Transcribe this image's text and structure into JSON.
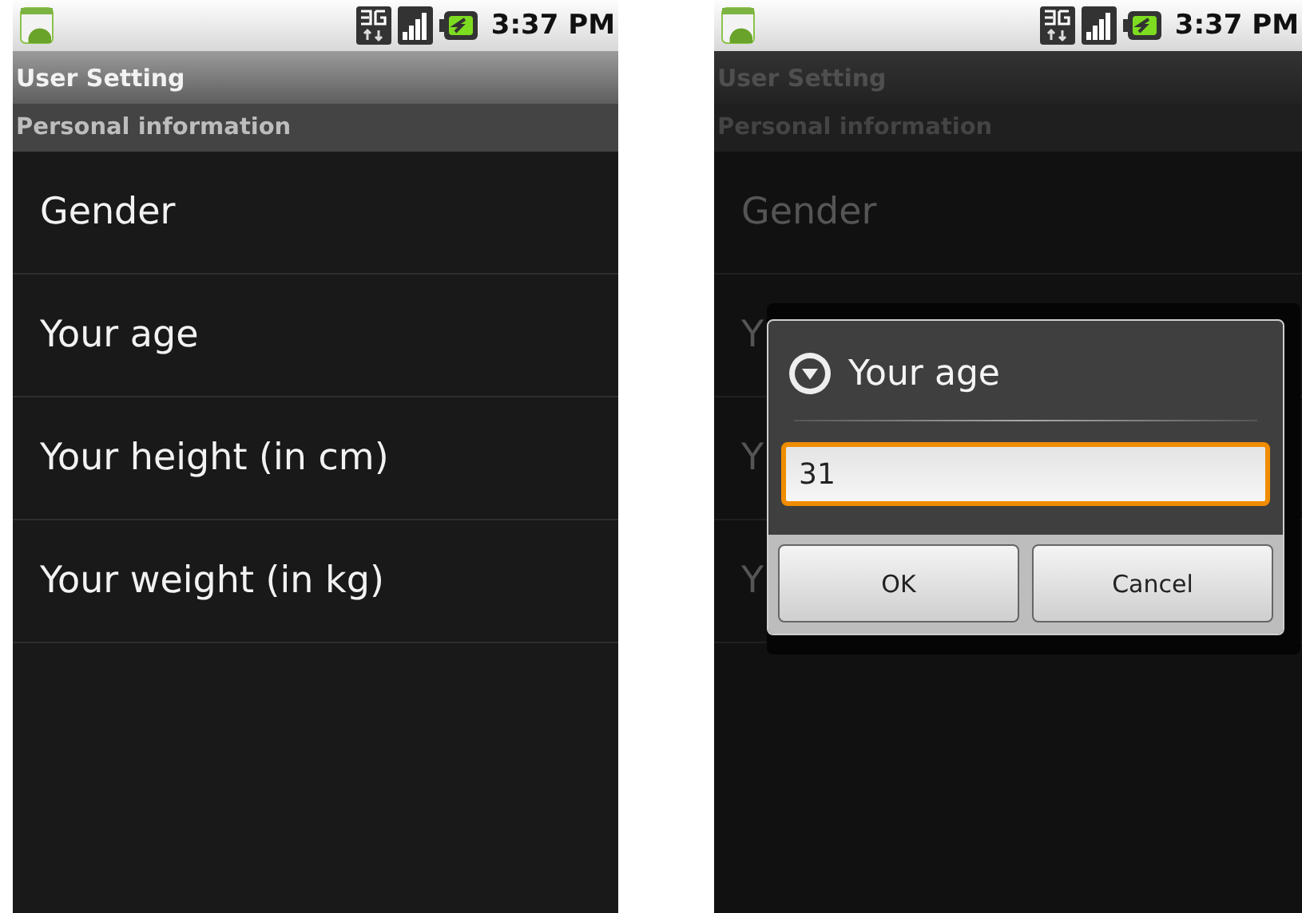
{
  "screens": [
    {
      "dimmed": false,
      "status_bar": {
        "time": "3:37 PM"
      },
      "title": "User Setting",
      "section": "Personal information",
      "items": [
        {
          "label": "Gender"
        },
        {
          "label": "Your age"
        },
        {
          "label": "Your height (in cm)"
        },
        {
          "label": "Your weight (in kg)"
        }
      ]
    },
    {
      "dimmed": true,
      "status_bar": {
        "time": "3:37 PM"
      },
      "title": "User Setting",
      "section": "Personal information",
      "items": [
        {
          "label": "Gender"
        },
        {
          "label": "Y"
        },
        {
          "label": "Y"
        },
        {
          "label": "Y"
        }
      ],
      "dialog": {
        "title": "Your age",
        "value": "31",
        "focused": true,
        "buttons": [
          "OK",
          "Cancel"
        ]
      }
    }
  ]
}
